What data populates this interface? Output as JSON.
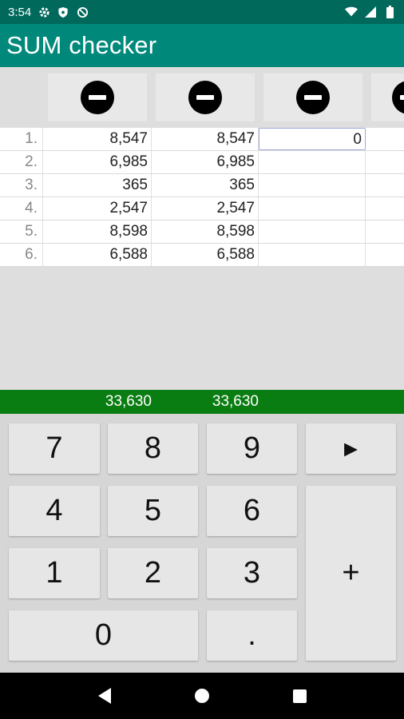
{
  "status_bar": {
    "time": "3:54",
    "left_icons": [
      "settings-icon",
      "shield-icon",
      "do-not-disturb-icon"
    ],
    "right_icons": [
      "wifi-icon",
      "cell-signal-icon",
      "battery-icon"
    ]
  },
  "app_bar": {
    "title": "SUM checker"
  },
  "columns": [
    {
      "remove_icon": "minus-circle-icon"
    },
    {
      "remove_icon": "minus-circle-icon"
    },
    {
      "remove_icon": "minus-circle-icon"
    },
    {
      "remove_icon": "minus-circle-icon"
    }
  ],
  "rows": [
    {
      "index": "1.",
      "a": "8,547",
      "b": "8,547",
      "c": "0",
      "d": ""
    },
    {
      "index": "2.",
      "a": "6,985",
      "b": "6,985",
      "c": "",
      "d": ""
    },
    {
      "index": "3.",
      "a": "365",
      "b": "365",
      "c": "",
      "d": ""
    },
    {
      "index": "4.",
      "a": "2,547",
      "b": "2,547",
      "c": "",
      "d": ""
    },
    {
      "index": "5.",
      "a": "8,598",
      "b": "8,598",
      "c": "",
      "d": ""
    },
    {
      "index": "6.",
      "a": "6,588",
      "b": "6,588",
      "c": "",
      "d": ""
    }
  ],
  "totals": {
    "a": "33,630",
    "b": "33,630"
  },
  "keypad": {
    "k7": "7",
    "k8": "8",
    "k9": "9",
    "next": "►",
    "k4": "4",
    "k5": "5",
    "k6": "6",
    "k1": "1",
    "k2": "2",
    "k3": "3",
    "plus": "+",
    "k0": "0",
    "dot": "."
  },
  "colors": {
    "status_bar": "#00695c",
    "app_bar": "#00897b",
    "totals_bar": "#0a7d12"
  },
  "nav_bar": {
    "icons": [
      "back-icon",
      "home-icon",
      "recents-icon"
    ]
  }
}
